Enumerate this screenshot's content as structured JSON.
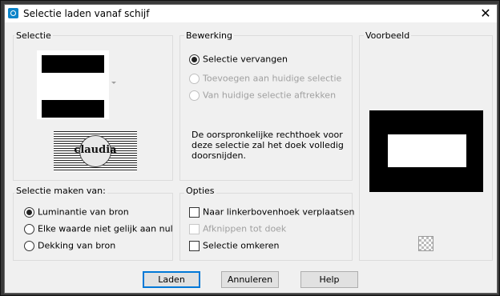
{
  "window": {
    "title": "Selectie laden vanaf schijf",
    "close_glyph": "✕"
  },
  "selectie": {
    "label": "Selectie"
  },
  "bewerking": {
    "label": "Bewerking",
    "options": [
      {
        "label": "Selectie vervangen",
        "checked": true,
        "enabled": true
      },
      {
        "label": "Toevoegen aan huidige selectie",
        "checked": false,
        "enabled": false
      },
      {
        "label": "Van huidige selectie aftrekken",
        "checked": false,
        "enabled": false
      }
    ],
    "description": "De oorspronkelijke rechthoek voor deze selectie zal het doek volledig doorsnijden."
  },
  "voorbeeld": {
    "label": "Voorbeeld"
  },
  "maken_van": {
    "label": "Selectie maken van:",
    "options": [
      {
        "label": "Luminantie van bron",
        "checked": true
      },
      {
        "label": "Elke waarde niet gelijk aan nul",
        "checked": false
      },
      {
        "label": "Dekking van bron",
        "checked": false
      }
    ]
  },
  "opties": {
    "label": "Opties",
    "items": [
      {
        "label": "Naar linkerbovenhoek verplaatsen",
        "checked": false,
        "enabled": true
      },
      {
        "label": "Afknippen tot doek",
        "checked": false,
        "enabled": false
      },
      {
        "label": "Selectie omkeren",
        "checked": false,
        "enabled": true
      }
    ]
  },
  "watermark": {
    "text": "claudia"
  },
  "buttons": {
    "load": "Laden",
    "cancel": "Annuleren",
    "help": "Help"
  }
}
